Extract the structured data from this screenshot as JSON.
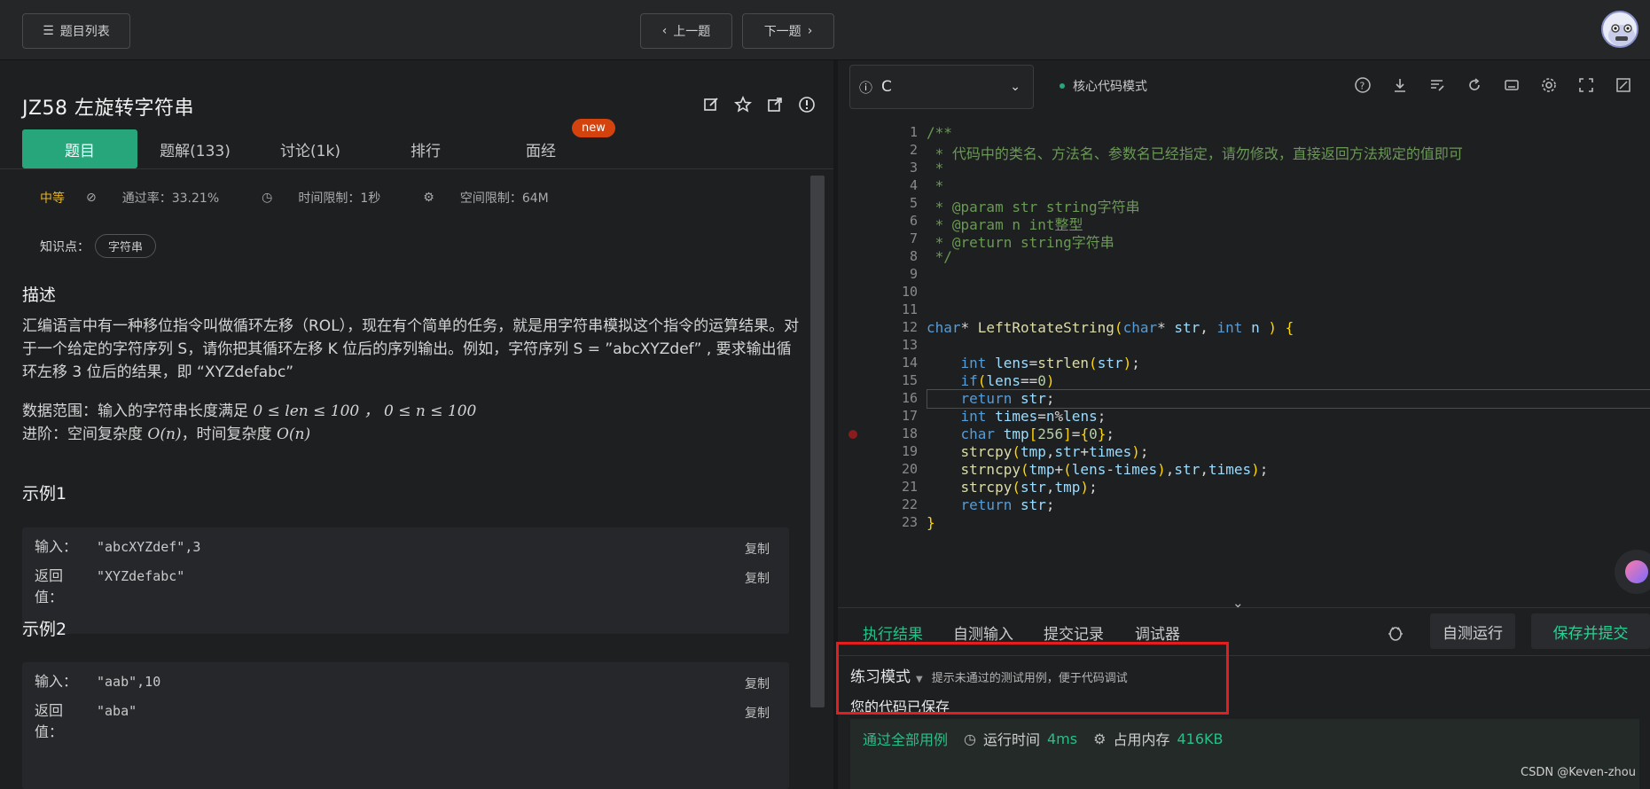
{
  "topbar": {
    "list_label": "题目列表",
    "prev_label": "上一题",
    "next_label": "下一题"
  },
  "problem": {
    "title": "JZ58  左旋转字符串",
    "tabs": [
      {
        "label": "题目"
      },
      {
        "label": "题解(133)"
      },
      {
        "label": "讨论(1k)"
      },
      {
        "label": "排行"
      },
      {
        "label": "面经"
      }
    ],
    "new_badge": "new",
    "difficulty": "中等",
    "pass_rate": "通过率：33.21%",
    "time_limit": "时间限制：1秒",
    "space_limit": "空间限制：64M",
    "knowledge_label": "知识点：",
    "knowledge_tag": "字符串",
    "desc_heading": "描述",
    "desc_text": "汇编语言中有一种移位指令叫做循环左移（ROL），现在有个简单的任务，就是用字符串模拟这个指令的运算结果。对于一个给定的字符序列  S，请你把其循环左移 K 位后的序列输出。例如，字符序列 S = ”abcXYZdef” , 要求输出循环左移 3 位后的结果，即 “XYZdefabc”",
    "range_prefix": "数据范围：输入的字符串长度满足 ",
    "range_math": "0 ≤ len ≤ 100 ， 0 ≤ n ≤ 100",
    "adv_prefix": "进阶：空间复杂度 ",
    "adv_math1": "O(n)",
    "adv_mid": "，时间复杂度 ",
    "adv_math2": "O(n)",
    "examples": [
      {
        "heading": "示例1",
        "input_label": "输入：",
        "input": "\"abcXYZdef\",3",
        "output_label": "返回值：",
        "output": "\"XYZdefabc\"",
        "copy": "复制"
      },
      {
        "heading": "示例2",
        "input_label": "输入：",
        "input": "\"aab\",10",
        "output_label": "返回值：",
        "output": "\"aba\"",
        "copy": "复制"
      }
    ]
  },
  "editor": {
    "language": "C",
    "mode": "核心代码模式",
    "code_lines": [
      "/**",
      " * 代码中的类名、方法名、参数名已经指定，请勿修改，直接返回方法规定的值即可",
      " *",
      " *",
      " * @param str string字符串",
      " * @param n int整型",
      " * @return string字符串",
      " */",
      "",
      "",
      "",
      "char* LeftRotateString(char* str, int n ) {",
      "",
      "    int lens=strlen(str);",
      "    if(lens==0)",
      "    return str;",
      "    int times=n%lens;",
      "    char tmp[256]={0};",
      "    strcpy(tmp,str+times);",
      "    strncpy(tmp+(lens-times),str,times);",
      "    strcpy(str,tmp);",
      "    return str;",
      "}"
    ],
    "line_numbers": [
      "1",
      "2",
      "3",
      "4",
      "5",
      "6",
      "7",
      "8",
      "9",
      "10",
      "11",
      "12",
      "13",
      "14",
      "15",
      "16",
      "17",
      "18",
      "19",
      "20",
      "21",
      "22",
      "23"
    ],
    "current_line": 16,
    "breakpoint_line": 18
  },
  "bottom": {
    "tabs": [
      "执行结果",
      "自测输入",
      "提交记录",
      "调试器"
    ],
    "run_label": "自测运行",
    "submit_label": "保存并提交",
    "practice_mode": "练习模式",
    "practice_hint": "提示未通过的测试用例，便于代码调试",
    "saved_msg": "您的代码已保存",
    "pass_all": "通过全部用例",
    "runtime_label": "运行时间",
    "runtime_value": "4ms",
    "memory_label": "占用内存",
    "memory_value": "416KB"
  },
  "watermark": "CSDN @Keven-zhou",
  "colors": {
    "accent": "#27a67b",
    "badge": "#d4430e",
    "highlight_box": "#e41e1e"
  }
}
